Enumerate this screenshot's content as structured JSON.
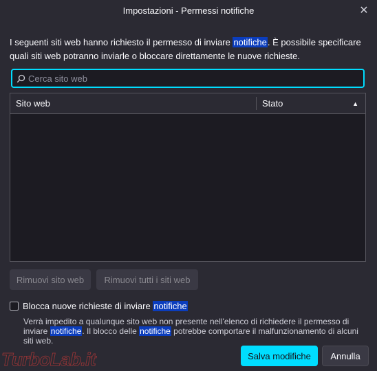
{
  "window": {
    "title": "Impostazioni - Permessi notifiche"
  },
  "intro": {
    "part1": "I seguenti siti web hanno richiesto il permesso di inviare ",
    "highlight": "notifiche",
    "part2": ". È possibile specificare quali siti web potranno inviarle o bloccare direttamente le nuove richieste."
  },
  "search": {
    "placeholder": "Cerca sito web",
    "value": ""
  },
  "table": {
    "columns": {
      "site": "Sito web",
      "status": "Stato"
    },
    "sort": {
      "column": "Stato",
      "direction": "ascending",
      "icon": "sort-up-triangle"
    },
    "rows": []
  },
  "buttons": {
    "remove_site": "Rimuovi sito web",
    "remove_all": "Rimuovi tutti i siti web",
    "save": "Salva modifiche",
    "cancel": "Annulla"
  },
  "block_checkbox": {
    "label_part1": "Blocca nuove richieste di inviare ",
    "label_highlight": "notifiche",
    "checked": false
  },
  "help_text": {
    "part1": "Verrà impedito a qualunque sito web non presente nell'elenco di richiedere il permesso di inviare ",
    "highlight1": "notifiche",
    "part2": ". Il blocco delle ",
    "highlight2": "notifiche",
    "part3": " potrebbe comportare il malfunzionamento di alcuni siti web."
  },
  "watermark": "TurboLab.it",
  "colors": {
    "background": "#2b2a33",
    "accent": "#00ddff",
    "highlight": "#0b3dbd",
    "text": "#fbfbfe"
  }
}
